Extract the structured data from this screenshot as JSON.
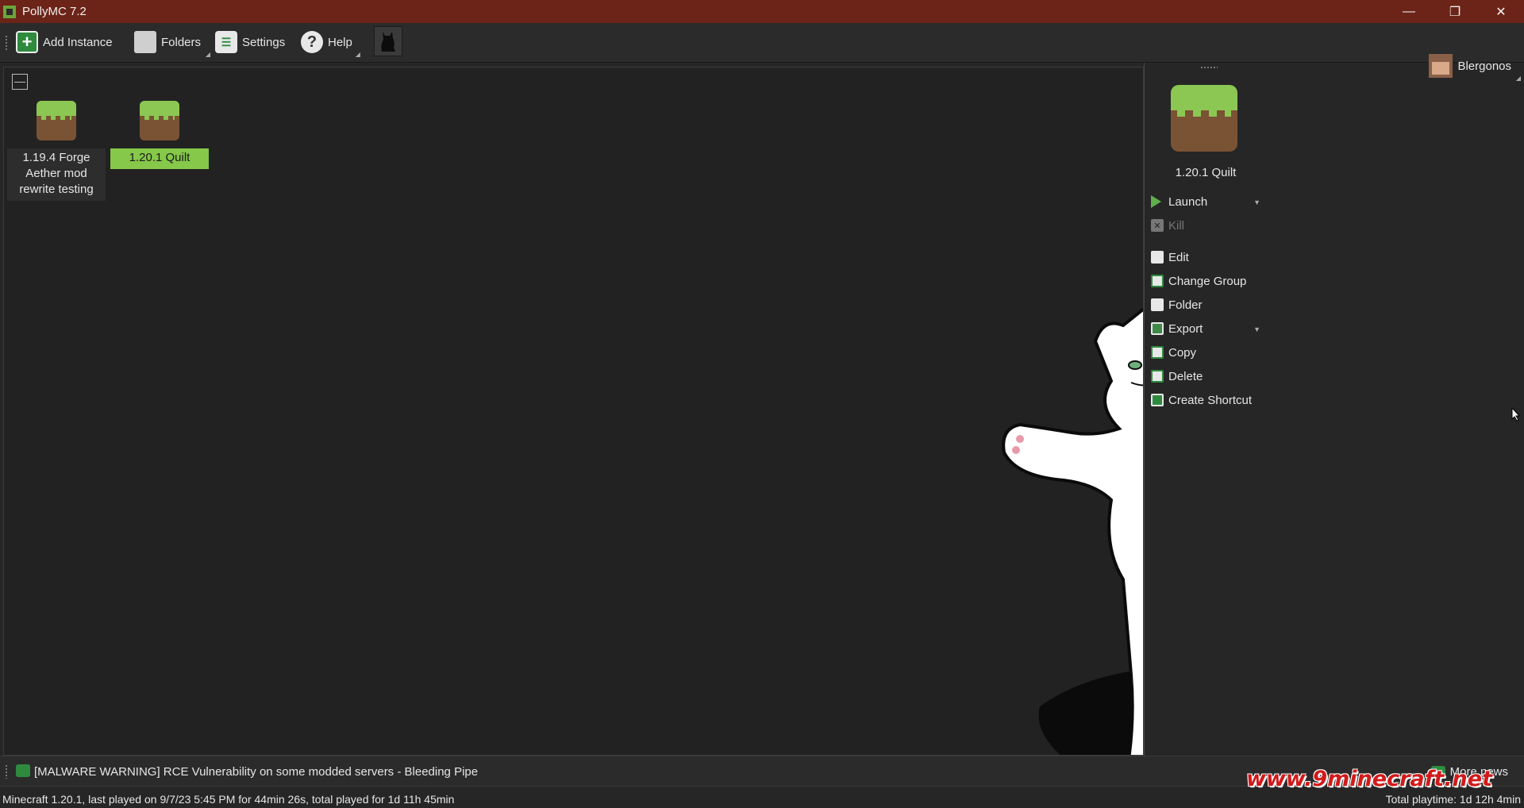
{
  "window": {
    "title": "PollyMC 7.2",
    "controls": [
      "minimize",
      "restore",
      "close"
    ]
  },
  "toolbar": {
    "add_instance": "Add Instance",
    "folders": "Folders",
    "settings": "Settings",
    "help": "Help",
    "account_name": "Blergonos"
  },
  "instances": [
    {
      "name": "1.19.4 Forge Aether mod rewrite testing",
      "selected": false
    },
    {
      "name": "1.20.1 Quilt",
      "selected": true
    }
  ],
  "panel": {
    "instance_name": "1.20.1 Quilt",
    "actions": {
      "launch": "Launch",
      "kill": "Kill",
      "edit": "Edit",
      "change_group": "Change Group",
      "folder": "Folder",
      "export": "Export",
      "copy": "Copy",
      "delete": "Delete",
      "create_shortcut": "Create Shortcut"
    }
  },
  "news": {
    "headline": "[MALWARE WARNING] RCE Vulnerability on some modded servers - Bleeding Pipe",
    "more_news": "More news"
  },
  "status": {
    "left": "Minecraft 1.20.1, last played on 9/7/23 5:45 PM for 44min 26s, total played for 1d 11h 45min",
    "right": "Total playtime: 1d 12h 4min"
  },
  "watermark": "www.9minecraft.net",
  "colors": {
    "titlebar": "#6c2418",
    "selected_instance": "#86c84a",
    "background": "#222222",
    "accent_green": "#2e8b3e",
    "yarn_blue": "#1f3f95"
  }
}
